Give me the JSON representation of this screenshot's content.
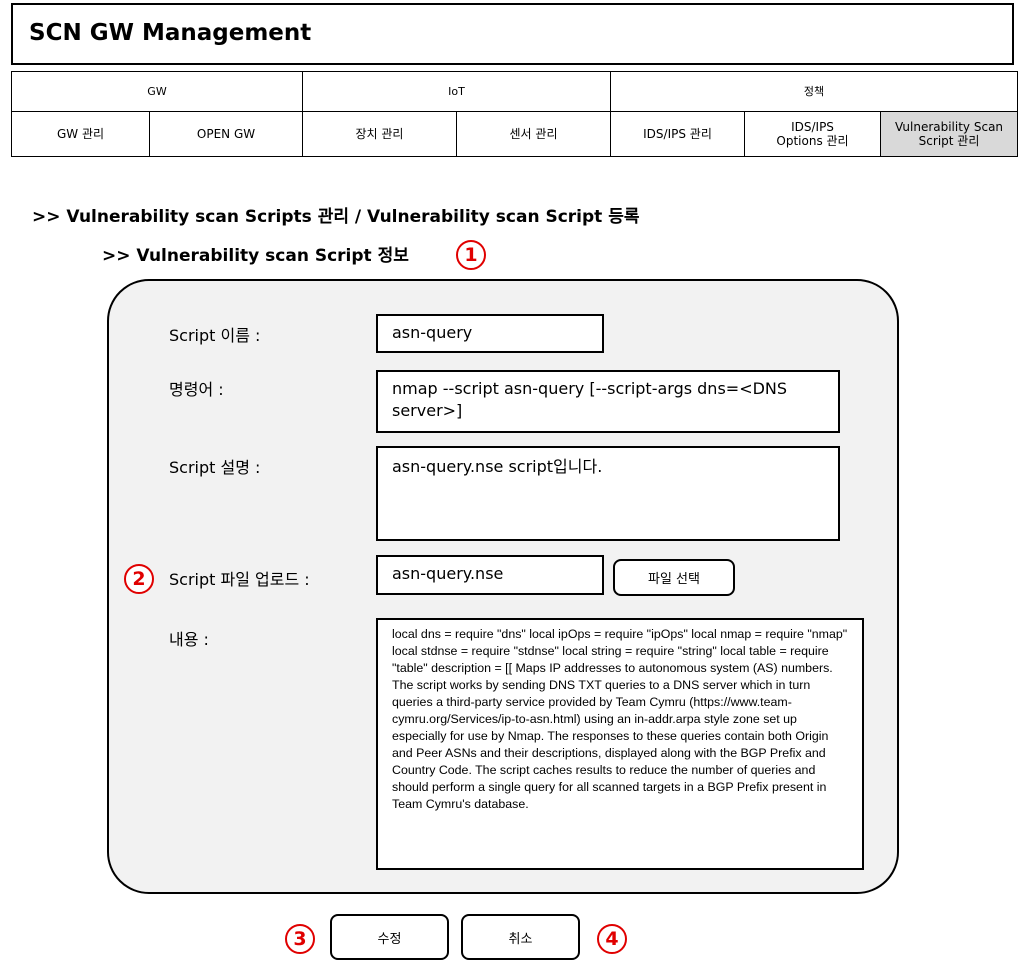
{
  "app": {
    "title": "SCN GW Management"
  },
  "nav": {
    "top": [
      "GW",
      "IoT",
      "정책"
    ],
    "sub": [
      {
        "label": "GW 관리"
      },
      {
        "label": "OPEN GW"
      },
      {
        "label": "장치 관리"
      },
      {
        "label": "센서 관리"
      },
      {
        "label": "IDS/IPS 관리"
      },
      {
        "label": "IDS/IPS\nOptions 관리"
      },
      {
        "label": "Vulnerability Scan\nScript 관리",
        "active": true
      }
    ]
  },
  "breadcrumb": ">> Vulnerability scan Scripts 관리 / Vulnerability scan Script 등록",
  "section_title": ">> Vulnerability scan Script 정보",
  "markers": [
    "1",
    "2",
    "3",
    "4"
  ],
  "form": {
    "name_label": "Script 이름 :",
    "name_value": "asn-query",
    "command_label": "명령어 :",
    "command_value": "nmap --script asn-query [--script-args dns=<DNS server>]",
    "desc_label": "Script 설명 :",
    "desc_value": "asn-query.nse  script입니다.",
    "upload_label": "Script 파일 업로드 :",
    "upload_value": "asn-query.nse",
    "file_button": "파일 선택",
    "content_label": "내용 :",
    "content_value": "local dns = require \"dns\" local ipOps = require \"ipOps\" local nmap = require \"nmap\" local stdnse = require \"stdnse\" local string = require \"string\" local table = require \"table\" description = [[ Maps IP addresses to autonomous system (AS) numbers. The script works by sending DNS TXT queries to a DNS server which in turn queries a third-party service provided by Team Cymru (https://www.team-cymru.org/Services/ip-to-asn.html) using an in-addr.arpa style zone set up especially for use by Nmap. The responses to these queries contain both Origin and Peer ASNs and their descriptions, displayed along with the BGP Prefix and Country Code. The script caches results to reduce the number of queries and should perform a single query for all scanned targets in a BGP Prefix present in Team Cymru's database."
  },
  "buttons": {
    "edit": "수정",
    "cancel": "취소"
  },
  "colors": {
    "marker": "#e00000",
    "active_tab": "#d9d9d9",
    "panel_bg": "#f2f2f2"
  }
}
